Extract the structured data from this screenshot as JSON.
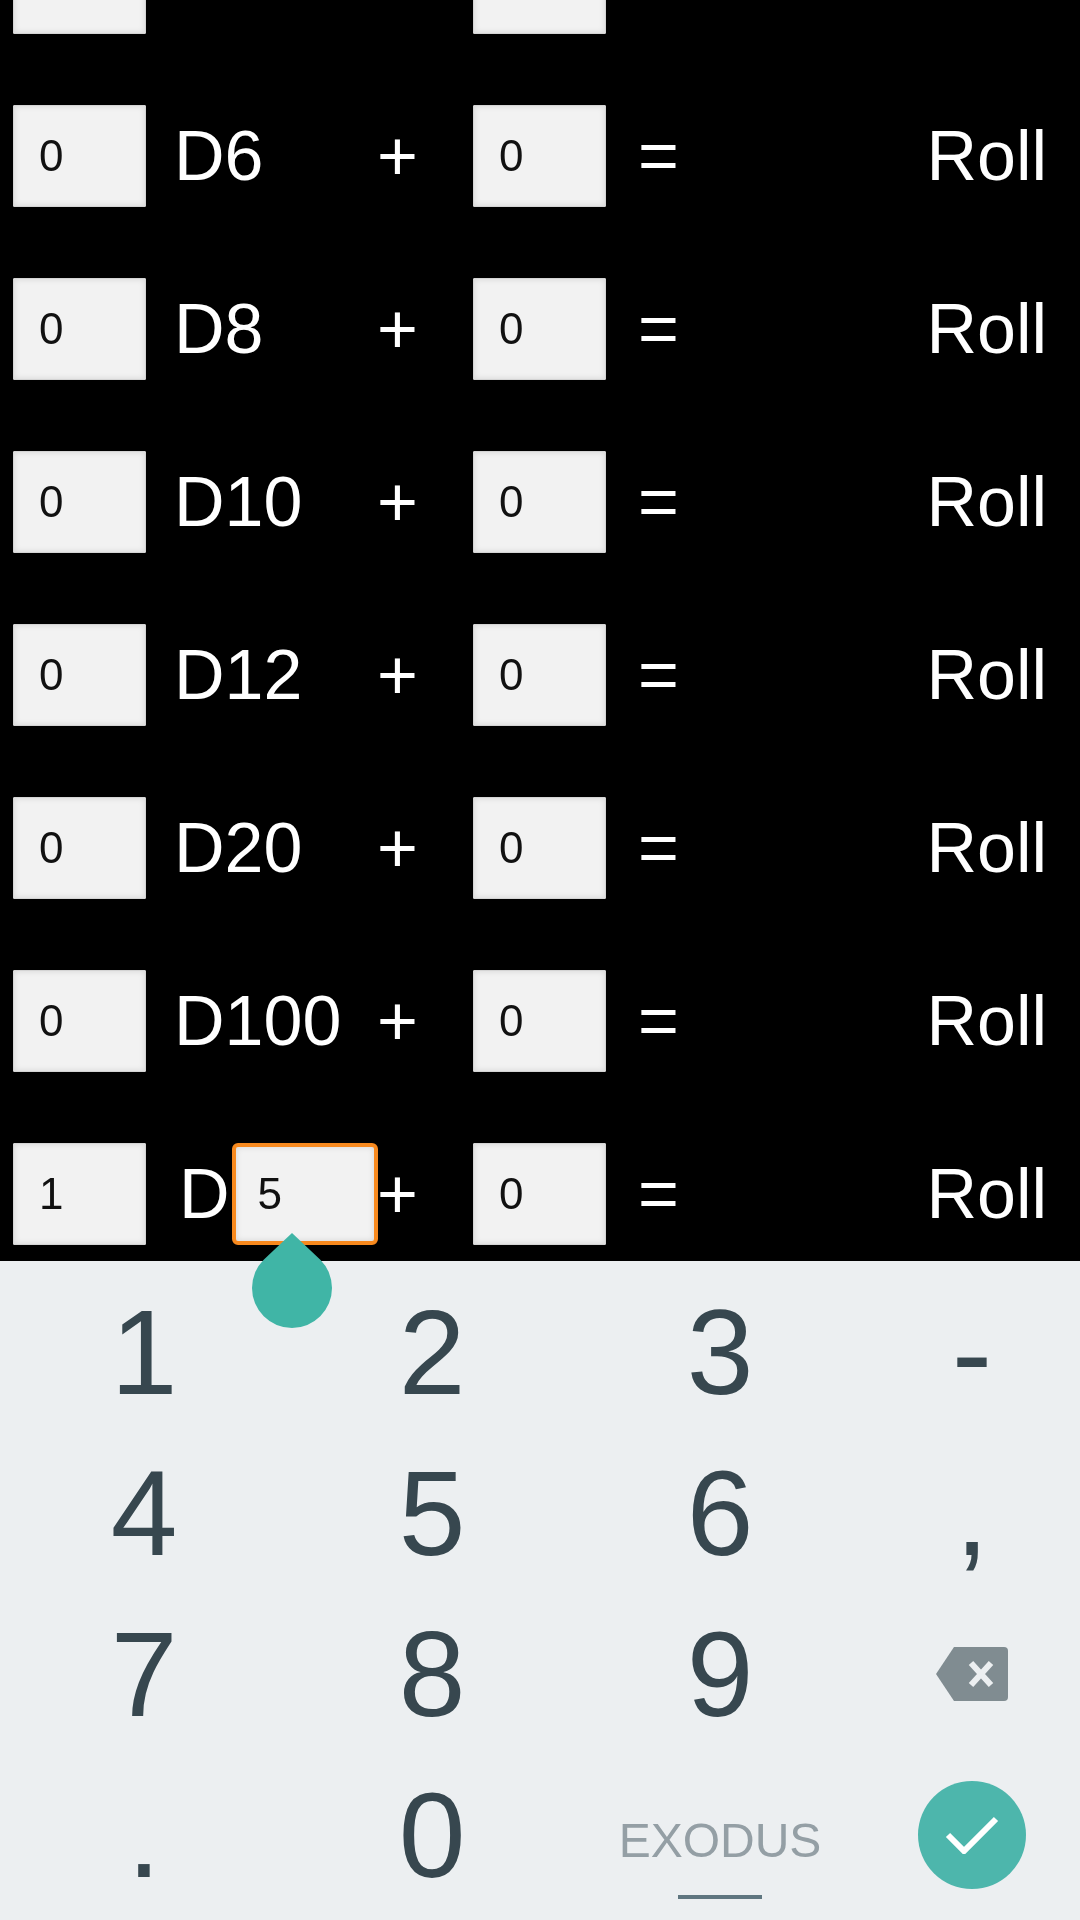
{
  "dice_rows": [
    {
      "kind": "cut"
    },
    {
      "kind": "standard",
      "count": "0",
      "die": "D6",
      "plus": "+",
      "modifier": "0",
      "equals": "=",
      "roll": "Roll"
    },
    {
      "kind": "standard",
      "count": "0",
      "die": "D8",
      "plus": "+",
      "modifier": "0",
      "equals": "=",
      "roll": "Roll"
    },
    {
      "kind": "standard",
      "count": "0",
      "die": "D10",
      "plus": "+",
      "modifier": "0",
      "equals": "=",
      "roll": "Roll"
    },
    {
      "kind": "standard",
      "count": "0",
      "die": "D12",
      "plus": "+",
      "modifier": "0",
      "equals": "=",
      "roll": "Roll"
    },
    {
      "kind": "standard",
      "count": "0",
      "die": "D20",
      "plus": "+",
      "modifier": "0",
      "equals": "=",
      "roll": "Roll"
    },
    {
      "kind": "standard",
      "count": "0",
      "die": "D100",
      "plus": "+",
      "modifier": "0",
      "equals": "=",
      "roll": "Roll"
    },
    {
      "kind": "custom",
      "count": "1",
      "die": "D",
      "sides": {
        "value": "5",
        "focused": true
      },
      "plus": "+",
      "modifier": "0",
      "equals": "=",
      "roll": "Roll"
    }
  ],
  "keyboard": {
    "keys": [
      {
        "kind": "char",
        "label": "1"
      },
      {
        "kind": "char",
        "label": "2"
      },
      {
        "kind": "char",
        "label": "3"
      },
      {
        "kind": "char",
        "label": "-"
      },
      {
        "kind": "char",
        "label": "4"
      },
      {
        "kind": "char",
        "label": "5"
      },
      {
        "kind": "char",
        "label": "6"
      },
      {
        "kind": "char",
        "label": ","
      },
      {
        "kind": "char",
        "label": "7"
      },
      {
        "kind": "char",
        "label": "8"
      },
      {
        "kind": "char",
        "label": "9"
      },
      {
        "kind": "backspace"
      },
      {
        "kind": "char",
        "label": "."
      },
      {
        "kind": "char",
        "label": "0"
      },
      {
        "kind": "switch",
        "label": "EXODUS"
      },
      {
        "kind": "done"
      }
    ]
  }
}
